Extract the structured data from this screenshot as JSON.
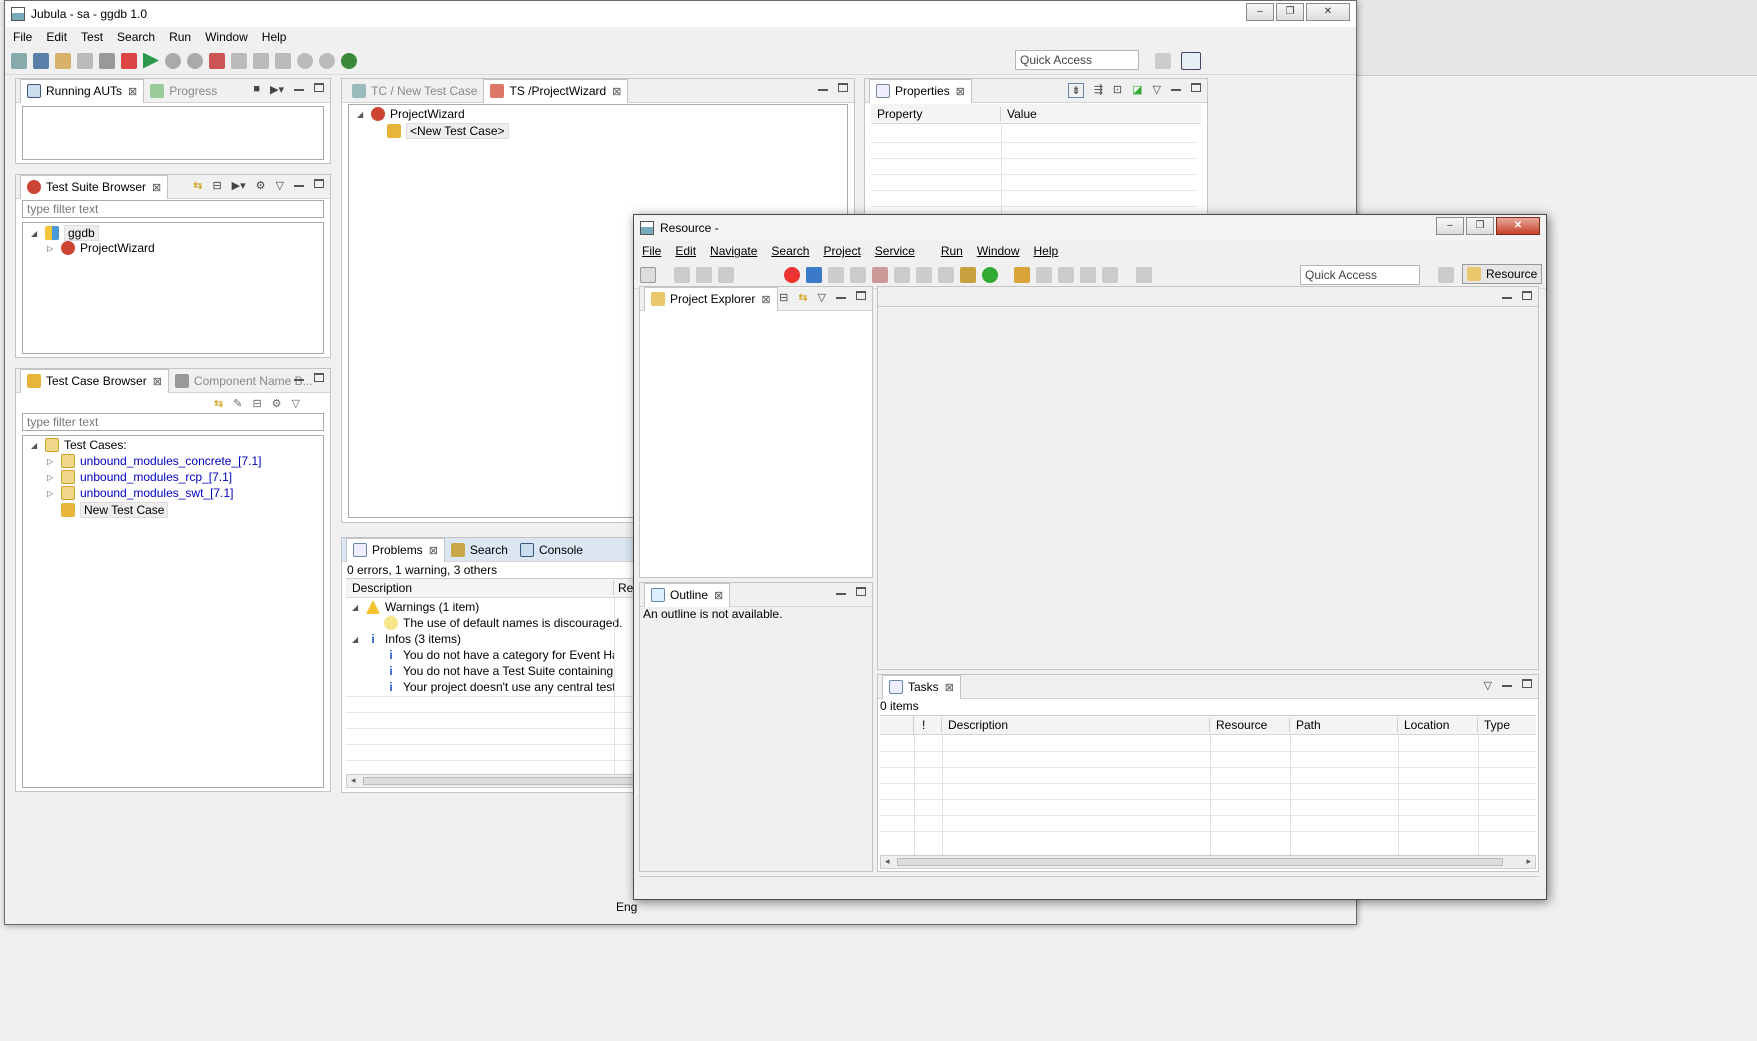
{
  "main_window": {
    "title": "Jubula - sa - ggdb 1.0",
    "menu": [
      "File",
      "Edit",
      "Test",
      "Search",
      "Run",
      "Window",
      "Help"
    ],
    "quick_access": "Quick Access",
    "running_auts": {
      "tab": "Running AUTs",
      "tab2": "Progress"
    },
    "test_suite_browser": {
      "tab": "Test Suite Browser",
      "filter_placeholder": "type filter text",
      "root": "ggdb",
      "child": "ProjectWizard"
    },
    "test_case_browser": {
      "tab": "Test Case Browser",
      "tab2": "Component Name B...",
      "filter_placeholder": "type filter text",
      "root": "Test Cases:",
      "items": [
        "unbound_modules_concrete_[7.1]",
        "unbound_modules_rcp_[7.1]",
        "unbound_modules_swt_[7.1]"
      ],
      "new_case": "New Test Case"
    },
    "editor": {
      "tab1": "TC / New Test Case",
      "tab2": "TS /ProjectWizard",
      "root": "ProjectWizard",
      "child": "<New Test Case>"
    },
    "properties": {
      "tab": "Properties",
      "col1": "Property",
      "col2": "Value"
    },
    "problems": {
      "tab": "Problems",
      "tab2": "Search",
      "tab3": "Console",
      "summary": "0 errors, 1 warning, 3 others",
      "col_desc": "Description",
      "col_res": "Res",
      "warnings": "Warnings (1 item)",
      "warning_1": "The use of default names is discouraged.",
      "infos": "Infos (3 items)",
      "info_1": "You do not have a category for Event Handle",
      "info_2": "You do not have a Test Suite containing all yo",
      "info_3": "Your project doesn't use any central test data"
    },
    "status_text": "Eng"
  },
  "resource_window": {
    "title": "Resource -",
    "menu": [
      "File",
      "Edit",
      "Navigate",
      "Search",
      "Project",
      "Service",
      "Run",
      "Window",
      "Help"
    ],
    "quick_access": "Quick Access",
    "perspective": "Resource",
    "project_explorer": "Project Explorer",
    "outline": {
      "tab": "Outline",
      "message": "An outline is not available."
    },
    "tasks": {
      "tab": "Tasks",
      "count": "0 items",
      "columns": [
        "!",
        "Description",
        "Resource",
        "Path",
        "Location",
        "Type"
      ]
    }
  },
  "colors": {
    "link": "#0000c0",
    "accent": "#3c7fb1"
  }
}
